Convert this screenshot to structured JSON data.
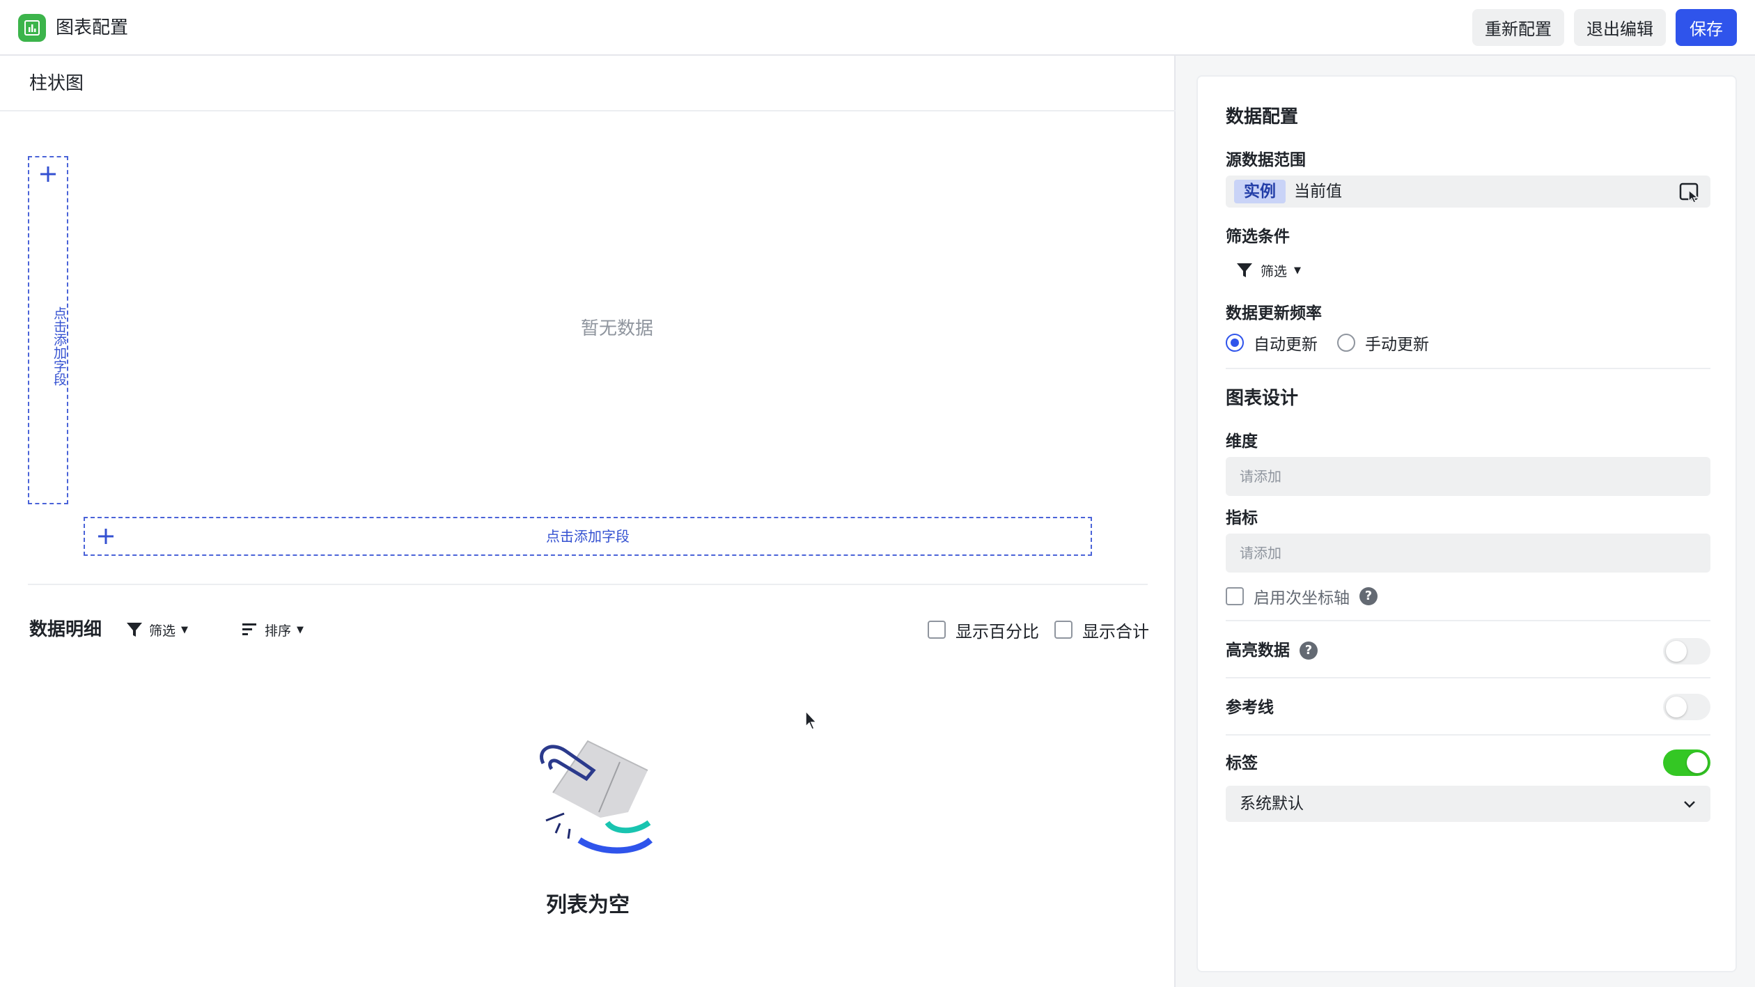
{
  "colors": {
    "primary": "#2f54eb",
    "success": "#34c724",
    "logo": "#3cb44b",
    "dashed": "#4a63d8"
  },
  "header": {
    "app_title": "图表配置",
    "reconfigure_label": "重新配置",
    "exit_edit_label": "退出编辑",
    "save_label": "保存"
  },
  "chart": {
    "type_label": "柱状图",
    "empty_text": "暂无数据",
    "add_field_label": "点击添加字段"
  },
  "detail": {
    "title": "数据明细",
    "filter_label": "筛选",
    "sort_label": "排序",
    "show_percent_label": "显示百分比",
    "show_total_label": "显示合计",
    "empty_list_text": "列表为空"
  },
  "config": {
    "data_section_title": "数据配置",
    "source_range_label": "源数据范围",
    "source_tag": "实例",
    "source_value": "当前值",
    "filter_condition_label": "筛选条件",
    "filter_button_label": "筛选",
    "update_freq_label": "数据更新频率",
    "auto_update_label": "自动更新",
    "manual_update_label": "手动更新",
    "design_section_title": "图表设计",
    "dimension_label": "维度",
    "dimension_placeholder": "请添加",
    "metric_label": "指标",
    "metric_placeholder": "请添加",
    "secondary_axis_label": "启用次坐标轴",
    "highlight_label": "高亮数据",
    "highlight_on": false,
    "reference_line_label": "参考线",
    "reference_line_on": false,
    "tag_label": "标签",
    "tag_on": true,
    "tag_select_value": "系统默认"
  }
}
